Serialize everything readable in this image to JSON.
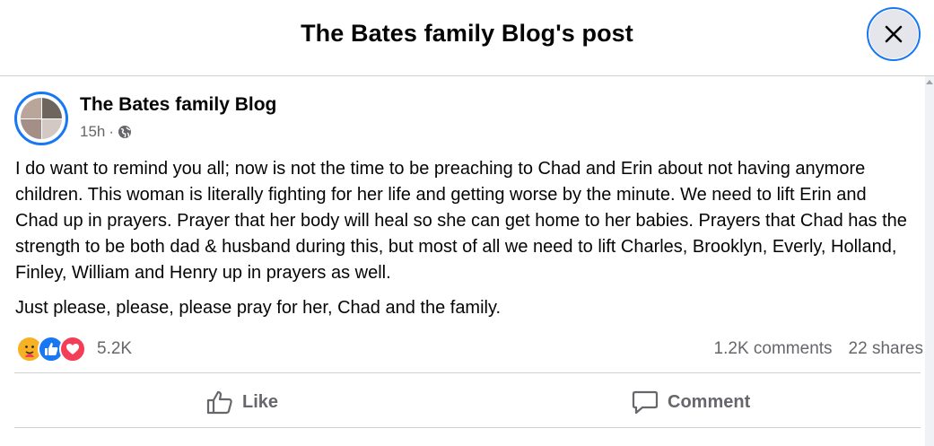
{
  "dialog": {
    "title": "The Bates family Blog's post"
  },
  "post": {
    "author": "The Bates family Blog",
    "time": "15h",
    "separator": "·",
    "privacy_icon": "globe-icon",
    "paragraphs": [
      "I do want to remind you all; now is not the time to be preaching to Chad and Erin about not having anymore children. This woman is literally fighting for her life and getting worse by the minute. We need to lift Erin and Chad up in prayers. Prayer that her body will heal so she can get home to her babies. Prayers that Chad has the strength to be both dad & husband during this, but most of all we need to lift Charles, Brooklyn, Everly, Holland, Finley, William and Henry up in prayers as well.",
      "Just please, please, please pray for her, Chad and the family."
    ]
  },
  "stats": {
    "reactions": [
      "care",
      "like",
      "love"
    ],
    "reaction_count": "5.2K",
    "comments": "1.2K comments",
    "shares": "22 shares"
  },
  "actions": {
    "like": "Like",
    "comment": "Comment"
  },
  "colors": {
    "accent": "#1877f2",
    "muted_text": "#65676b",
    "divider": "#ced0d4",
    "love": "#f33e58",
    "care": "#f7b125"
  }
}
